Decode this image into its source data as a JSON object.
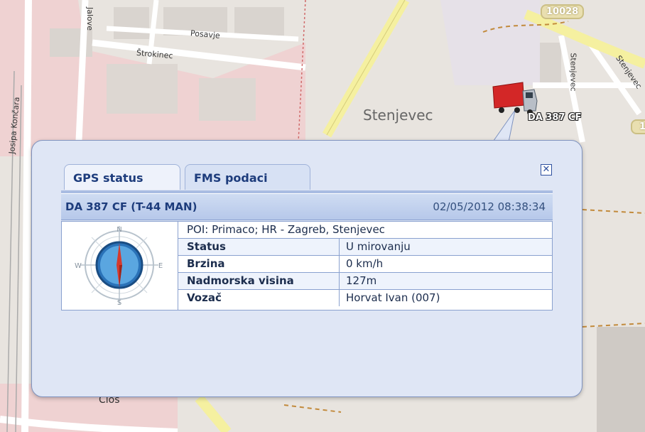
{
  "map": {
    "place_labels": [
      "Stenjevec",
      "Posavje",
      "Štrokinec",
      "Jalove",
      "Josipa Končara",
      "Stenjevec",
      "Stenjevec",
      "Cios"
    ],
    "road_badge": "10028",
    "road_badge_right": "1"
  },
  "vehicle_marker": {
    "label": "DA 387 CF",
    "icon": "truck-icon"
  },
  "popup": {
    "close_icon": "close-icon",
    "tabs": [
      {
        "label": "GPS status",
        "active": true
      },
      {
        "label": "FMS podaci",
        "active": false
      }
    ],
    "vehicle": {
      "title": "DA 387 CF (T-44 MAN)",
      "datetime": "02/05/2012 08:38:34"
    },
    "compass_icon": "compass-icon",
    "compass_letters": {
      "n": "N",
      "s": "S",
      "e": "E",
      "w": "W"
    },
    "poi": "POI: Primaco; HR - Zagreb, Stenjevec",
    "rows": [
      {
        "key": "Status",
        "value": "U mirovanju"
      },
      {
        "key": "Brzina",
        "value": "0 km/h"
      },
      {
        "key": "Nadmorska visina",
        "value": "127m"
      },
      {
        "key": "Vozač",
        "value": "Horvat Ivan (007)"
      }
    ]
  },
  "colors": {
    "popup_bg": "#dfe6f5",
    "tab_text": "#1d3c7c",
    "border": "#8aa1cf"
  }
}
